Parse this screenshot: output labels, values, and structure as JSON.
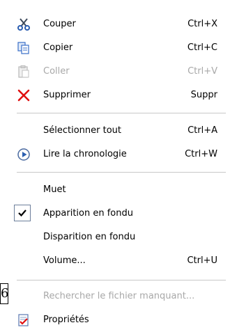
{
  "menu": {
    "items": [
      {
        "label": "Couper",
        "shortcut": "Ctrl+X",
        "icon": "scissors-icon",
        "enabled": true
      },
      {
        "label": "Copier",
        "shortcut": "Ctrl+C",
        "icon": "copy-icon",
        "enabled": true
      },
      {
        "label": "Coller",
        "shortcut": "Ctrl+V",
        "icon": "paste-icon",
        "enabled": false
      },
      {
        "label": "Supprimer",
        "shortcut": "Suppr",
        "icon": "delete-x-icon",
        "enabled": true
      },
      {
        "label": "Sélectionner tout",
        "shortcut": "Ctrl+A",
        "enabled": true
      },
      {
        "label": "Lire la chronologie",
        "shortcut": "Ctrl+W",
        "icon": "play-circle-icon",
        "enabled": true
      },
      {
        "label": "Muet",
        "shortcut": "",
        "enabled": true
      },
      {
        "label": "Apparition en fondu",
        "shortcut": "",
        "icon": "checkmark-icon",
        "checked": true,
        "enabled": true
      },
      {
        "label": "Disparition en fondu",
        "shortcut": "",
        "enabled": true
      },
      {
        "label": "Volume...",
        "shortcut": "Ctrl+U",
        "enabled": true
      },
      {
        "label": "Rechercher le fichier manquant...",
        "shortcut": "",
        "enabled": false
      },
      {
        "label": "Propriétés",
        "shortcut": "",
        "icon": "properties-icon",
        "enabled": true
      }
    ]
  },
  "side_marker": {
    "text": "6"
  },
  "colors": {
    "disabled_text": "#a8a8a8",
    "separator": "#c8c8c8",
    "delete_red": "#e01010",
    "copy_blue": "#3a6fc8"
  }
}
